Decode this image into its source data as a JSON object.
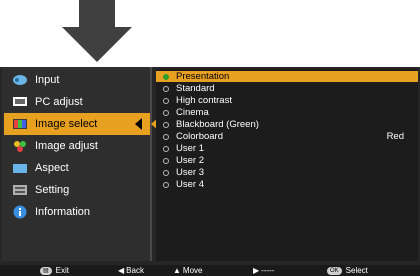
{
  "colors": {
    "accent": "#e8a020",
    "panel": "#262626",
    "submenu": "#1c1c1c"
  },
  "sidebar": {
    "items": [
      {
        "label": "Input",
        "icon": "input-icon"
      },
      {
        "label": "PC adjust",
        "icon": "pc-adjust-icon"
      },
      {
        "label": "Image select",
        "icon": "image-select-icon"
      },
      {
        "label": "Image adjust",
        "icon": "image-adjust-icon"
      },
      {
        "label": "Aspect",
        "icon": "aspect-icon"
      },
      {
        "label": "Setting",
        "icon": "setting-icon"
      },
      {
        "label": "Information",
        "icon": "information-icon"
      }
    ],
    "selected": "Image select"
  },
  "submenu": {
    "items": [
      {
        "label": "Presentation",
        "value": ""
      },
      {
        "label": "Standard",
        "value": ""
      },
      {
        "label": "High contrast",
        "value": ""
      },
      {
        "label": "Cinema",
        "value": ""
      },
      {
        "label": "Blackboard (Green)",
        "value": ""
      },
      {
        "label": "Colorboard",
        "value": "Red"
      },
      {
        "label": "User 1",
        "value": ""
      },
      {
        "label": "User 2",
        "value": ""
      },
      {
        "label": "User 3",
        "value": ""
      },
      {
        "label": "User 4",
        "value": ""
      }
    ],
    "selected": "Presentation"
  },
  "statusbar": {
    "exit": "Exit",
    "back": "Back",
    "move": "Move",
    "next": "-----",
    "ok_key": "OK",
    "select": "Select"
  }
}
